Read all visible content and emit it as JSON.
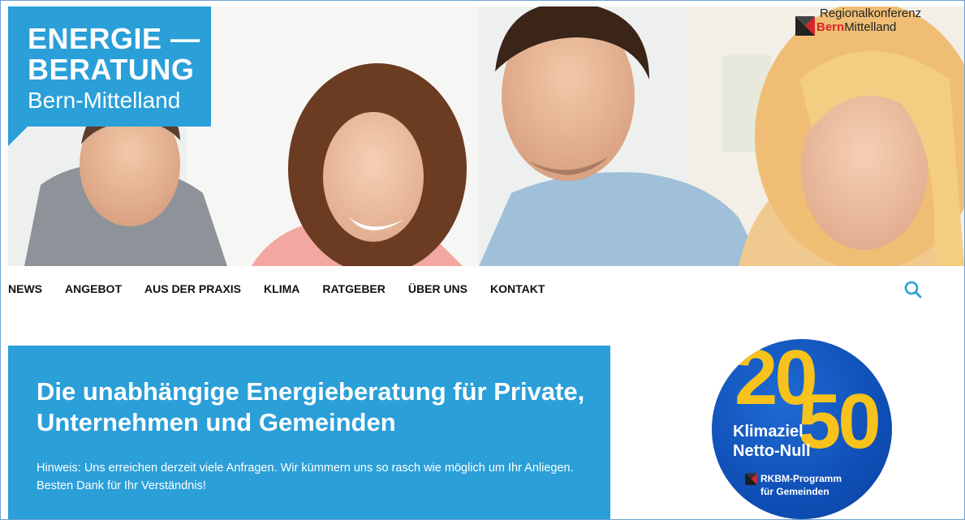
{
  "logo": {
    "line1": "ENERGIE —",
    "line2": "BERATUNG",
    "line3": "Bern-Mittelland"
  },
  "partner_logo": {
    "line1": "Regionalkonferenz",
    "line2_red": "Bern",
    "line2_rest": "Mittelland"
  },
  "nav": {
    "items": [
      {
        "label": "NEWS"
      },
      {
        "label": "ANGEBOT"
      },
      {
        "label": "AUS DER PRAXIS"
      },
      {
        "label": "KLIMA"
      },
      {
        "label": "RATGEBER"
      },
      {
        "label": "ÜBER UNS"
      },
      {
        "label": "KONTAKT"
      }
    ],
    "search_icon": "search-icon"
  },
  "intro": {
    "title": "Die unabhängige Energieberatung für Private, Unternehmen und Gemeinden",
    "notice": "Hinweis: Uns erreichen derzeit viele Anfragen. Wir kümmern uns so rasch wie möglich um Ihr Anliegen. Besten Dank für Ihr Verständnis!"
  },
  "badge": {
    "year_part1": "20",
    "year_part2": "50",
    "line1": "Klimaziel",
    "line2": "Netto-Null",
    "program_line1": "RKBM-Programm",
    "program_line2": "für Gemeinden"
  },
  "colors": {
    "brand_blue": "#2a9fd8",
    "badge_blue": "#0f4fb6",
    "badge_yellow": "#f7c21c",
    "partner_red": "#d6242a",
    "search_icon_color": "#2a9fd8"
  }
}
